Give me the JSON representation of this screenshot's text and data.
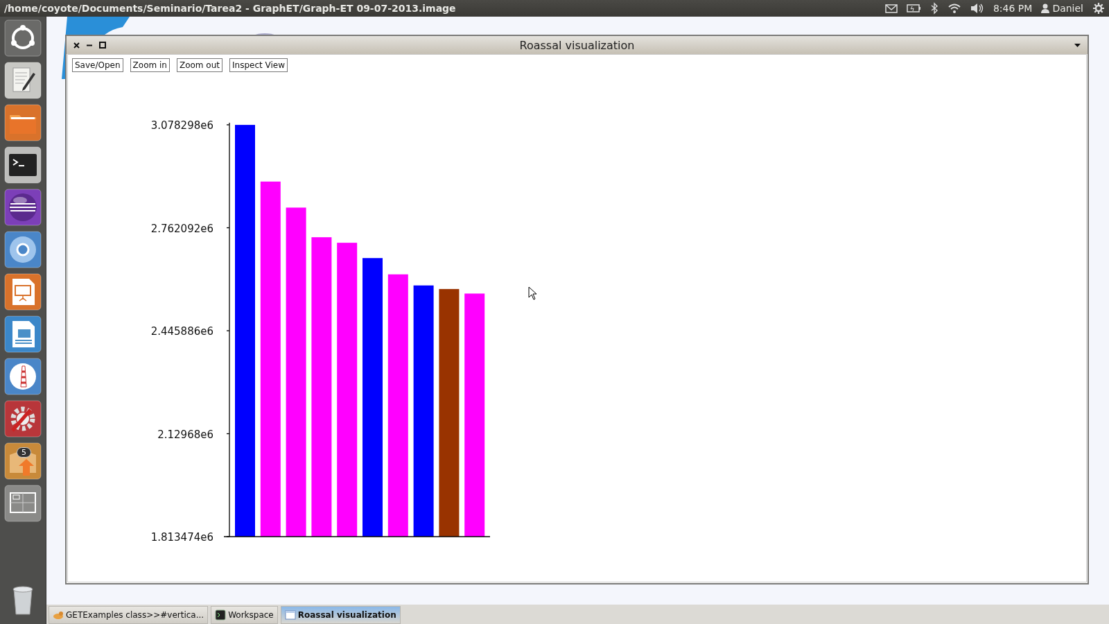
{
  "top_panel": {
    "title": "/home/coyote/Documents/Seminario/Tarea2 - GraphET/Graph-ET 09-07-2013.image",
    "clock": "8:46 PM",
    "user": "Daniel"
  },
  "launcher": {
    "badge": "5"
  },
  "window": {
    "title": "Roassal visualization",
    "buttons": [
      "Save/Open",
      "Zoom in",
      "Zoom out",
      "Inspect View"
    ],
    "chart_data": {
      "type": "bar",
      "series": [
        {
          "color": "#0000ff",
          "values": [
            3078000,
            null,
            null,
            null,
            null,
            2669000,
            null,
            2585000,
            null,
            null
          ]
        },
        {
          "color": "#ff00ff",
          "values": [
            null,
            2904000,
            2824000,
            2733000,
            2716000,
            null,
            2619000,
            null,
            null,
            2560000
          ]
        },
        {
          "color": "#993300",
          "values": [
            null,
            null,
            null,
            null,
            null,
            null,
            null,
            null,
            2574000,
            null
          ]
        }
      ],
      "ylim": [
        1813474,
        3078298
      ],
      "yticks": [
        {
          "value": 1813474,
          "label": "1.813474e6"
        },
        {
          "value": 2129680,
          "label": "2.12968e6"
        },
        {
          "value": 2445886,
          "label": "2.445886e6"
        },
        {
          "value": 2762092,
          "label": "2.762092e6"
        },
        {
          "value": 3078298,
          "label": "3.078298e6"
        }
      ]
    }
  },
  "taskbar": [
    {
      "label": "GETExamples class>>#vertica...",
      "selected": false
    },
    {
      "label": "Workspace",
      "selected": false
    },
    {
      "label": "Roassal visualization",
      "selected": true
    }
  ]
}
